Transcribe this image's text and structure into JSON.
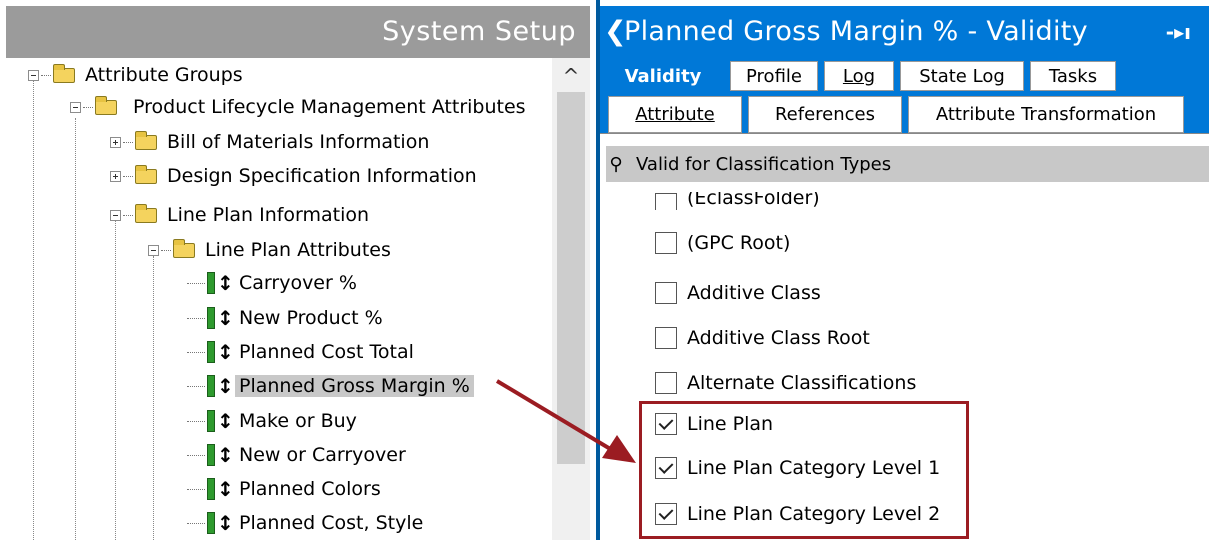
{
  "left": {
    "title": "System Setup",
    "tree": [
      {
        "label": "Attribute Groups",
        "type": "folder",
        "expander": "minus"
      },
      {
        "label": "Product Lifecycle Management Attributes",
        "type": "folder",
        "expander": "minus"
      },
      {
        "label": "Bill of Materials Information",
        "type": "folder",
        "expander": "plus"
      },
      {
        "label": "Design Specification Information",
        "type": "folder",
        "expander": "plus"
      },
      {
        "label": "Line Plan Information",
        "type": "folder",
        "expander": "minus"
      },
      {
        "label": "Line Plan Attributes",
        "type": "folder",
        "expander": "minus"
      },
      {
        "label": "Carryover %",
        "type": "attribute"
      },
      {
        "label": "New Product %",
        "type": "attribute"
      },
      {
        "label": "Planned Cost Total",
        "type": "attribute"
      },
      {
        "label": "Planned Gross Margin %",
        "type": "attribute",
        "selected": true
      },
      {
        "label": "Make or Buy",
        "type": "attribute"
      },
      {
        "label": "New or Carryover",
        "type": "attribute"
      },
      {
        "label": "Planned Colors",
        "type": "attribute"
      },
      {
        "label": "Planned Cost, Style",
        "type": "attribute"
      }
    ]
  },
  "right": {
    "title": "Planned Gross Margin % - Validity",
    "back_icon": "chevron-left-icon",
    "pin_icon": "pin-icon",
    "tabs_row1": [
      {
        "label": "Validity",
        "active": true
      },
      {
        "label": "Profile"
      },
      {
        "label": "Log",
        "underline": "L"
      },
      {
        "label": "State Log"
      },
      {
        "label": "Tasks"
      }
    ],
    "tabs_row2": [
      {
        "label": "Attribute",
        "underline": "A"
      },
      {
        "label": "References"
      },
      {
        "label": "Attribute Transformation"
      }
    ],
    "section_title": "Valid for Classification Types",
    "classification_types": [
      {
        "label": "(EclassFolder)",
        "checked": false
      },
      {
        "label": "(GPC Root)",
        "checked": false
      },
      {
        "label": "Additive Class",
        "checked": false
      },
      {
        "label": "Additive Class Root",
        "checked": false
      },
      {
        "label": "Alternate Classifications",
        "checked": false
      },
      {
        "label": "Line Plan",
        "checked": true
      },
      {
        "label": "Line Plan Category Level 1",
        "checked": true
      },
      {
        "label": "Line Plan Category Level 2",
        "checked": true
      }
    ]
  },
  "colors": {
    "accent": "#0078d7",
    "header_gray": "#9b9b9b",
    "annotation": "#9b1c22",
    "folder": "#f4d35e",
    "attribute_icon": "#2e9a2e"
  }
}
